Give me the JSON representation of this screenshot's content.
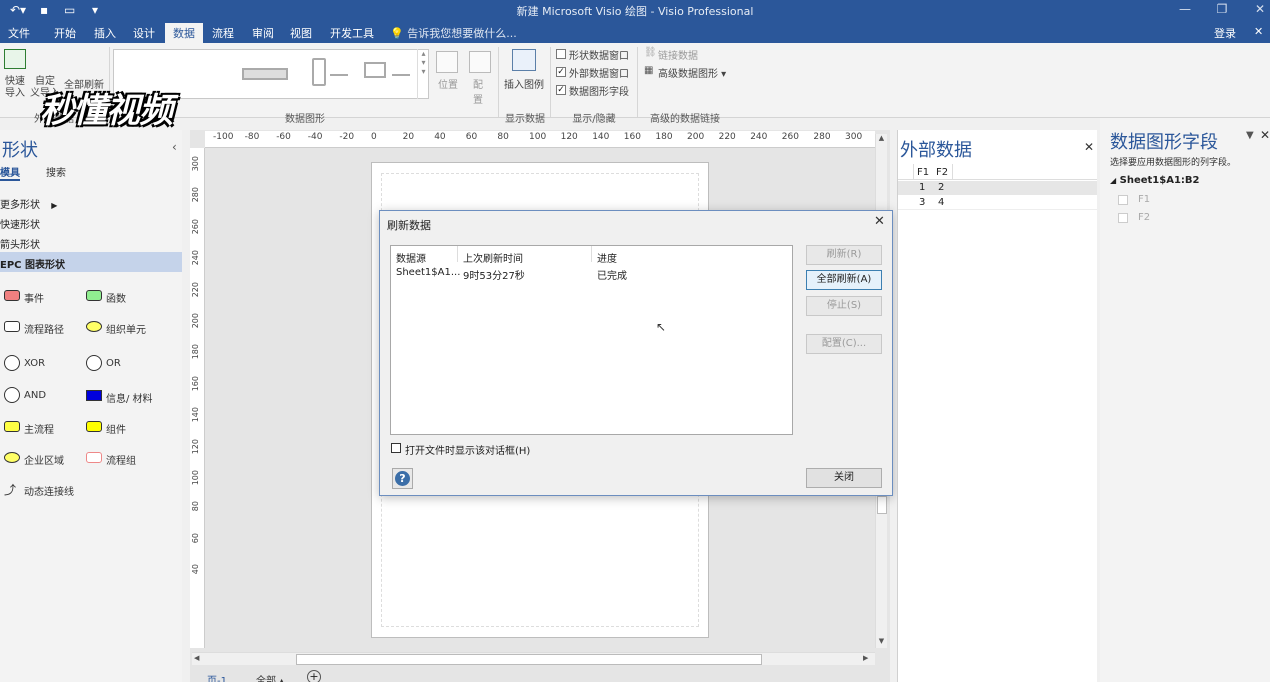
{
  "titlebar": {
    "title": "新建 Microsoft Visio 绘图 - Visio Professional"
  },
  "menu": {
    "items": [
      "文件",
      "开始",
      "插入",
      "设计",
      "数据",
      "流程",
      "审阅",
      "视图",
      "开发工具"
    ],
    "active": "数据",
    "tellme": "告诉我您想要做什么...",
    "login": "登录"
  },
  "ribbon": {
    "quick_import": "快速\n导入",
    "custom_import": "自定\n义导入",
    "refresh_all": "全部刷新",
    "group_external": "外部数据",
    "group_graphics": "数据图形",
    "position": "位置",
    "config": "配置",
    "insert_legend": "插入图例",
    "group_show": "显示数据",
    "chk_shape_data": "形状数据窗口",
    "chk_external": "外部数据窗口",
    "chk_graphic_fields": "数据图形字段",
    "group_showhide": "显示/隐藏",
    "link_data": "链接数据",
    "advanced_graphics": "高级数据图形",
    "group_advanced": "高级的数据链接",
    "watermark": "秒懂视频"
  },
  "shapes": {
    "title": "形状",
    "tab_stencil": "模具",
    "tab_search": "搜索",
    "more": "更多形状",
    "quick": "快速形状",
    "arrow": "箭头形状",
    "epc": "EPC 图表形状",
    "items": [
      {
        "label": "事件",
        "color": "#f08080",
        "shape": "rect"
      },
      {
        "label": "函数",
        "color": "#90ee90",
        "shape": "rect"
      },
      {
        "label": "流程路径",
        "color": "#ffffff",
        "shape": "rect"
      },
      {
        "label": "组织单元",
        "color": "#ffff66",
        "shape": "ellipse"
      },
      {
        "label": "XOR",
        "color": "#ffffff",
        "shape": "circle"
      },
      {
        "label": "OR",
        "color": "#ffffff",
        "shape": "circle"
      },
      {
        "label": "AND",
        "color": "#ffffff",
        "shape": "circle"
      },
      {
        "label": "信息/ 材料",
        "color": "#0000dd",
        "shape": "rect"
      },
      {
        "label": "主流程",
        "color": "#ffff44",
        "shape": "rect"
      },
      {
        "label": "组件",
        "color": "#ffff00",
        "shape": "rect"
      },
      {
        "label": "企业区域",
        "color": "#ffff66",
        "shape": "ellipse"
      },
      {
        "label": "流程组",
        "color": "#ffffff",
        "shape": "rect"
      },
      {
        "label": "动态连接线",
        "color": "#ffffff",
        "shape": "connector"
      }
    ]
  },
  "ruler": {
    "h_ticks": [
      "-100",
      "-80",
      "-60",
      "-40",
      "-20",
      "0",
      "20",
      "40",
      "60",
      "80",
      "100",
      "120",
      "140",
      "160",
      "180",
      "200",
      "220",
      "240",
      "260",
      "280",
      "300"
    ],
    "v_ticks": [
      "300",
      "280",
      "260",
      "240",
      "220",
      "200",
      "180",
      "160",
      "140",
      "120",
      "100",
      "80",
      "60",
      "40"
    ]
  },
  "dialog": {
    "title": "刷新数据",
    "columns": [
      "数据源",
      "上次刷新时间",
      "进度"
    ],
    "rows": [
      {
        "source": "Sheet1$A1...",
        "time": "9时53分27秒",
        "status": "已完成"
      }
    ],
    "btn_refresh": "刷新(R)",
    "btn_refresh_all": "全部刷新(A)",
    "btn_stop": "停止(S)",
    "btn_config": "配置(C)...",
    "chk_show": "打开文件时显示该对话框(H)",
    "btn_close": "关闭",
    "help": "?"
  },
  "ext": {
    "title": "外部数据",
    "headers": [
      "F1",
      "F2"
    ],
    "rows": [
      [
        "1",
        "2"
      ],
      [
        "3",
        "4"
      ]
    ]
  },
  "fields": {
    "title": "数据图形字段",
    "subtitle": "选择要应用数据图形的列字段。",
    "group": "Sheet1$A1:B2",
    "items": [
      "F1",
      "F2"
    ]
  },
  "bottom": {
    "page_tab": "页-1",
    "all": "全部"
  }
}
